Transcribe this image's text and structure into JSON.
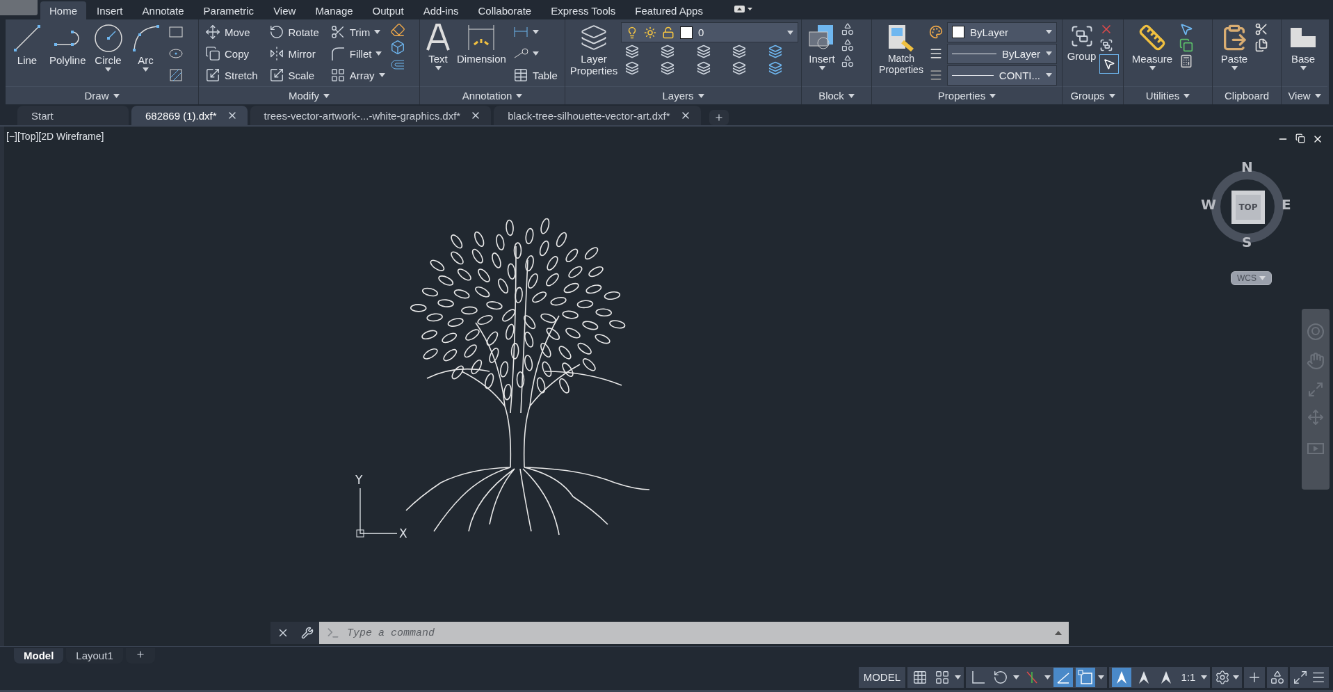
{
  "menu_tabs": [
    {
      "label": "Home",
      "selected": true
    },
    {
      "label": "Insert",
      "selected": false
    },
    {
      "label": "Annotate",
      "selected": false
    },
    {
      "label": "Parametric",
      "selected": false
    },
    {
      "label": "View",
      "selected": false
    },
    {
      "label": "Manage",
      "selected": false
    },
    {
      "label": "Output",
      "selected": false
    },
    {
      "label": "Add-ins",
      "selected": false
    },
    {
      "label": "Collaborate",
      "selected": false
    },
    {
      "label": "Express Tools",
      "selected": false
    },
    {
      "label": "Featured Apps",
      "selected": false
    }
  ],
  "ribbon": {
    "draw": {
      "title": "Draw",
      "tools": [
        "Line",
        "Polyline",
        "Circle",
        "Arc"
      ]
    },
    "modify": {
      "title": "Modify",
      "tools": [
        "Move",
        "Rotate",
        "Trim",
        "Copy",
        "Mirror",
        "Fillet",
        "Stretch",
        "Scale",
        "Array"
      ]
    },
    "annotation": {
      "title": "Annotation",
      "tools": [
        "Text",
        "Dimension"
      ],
      "table": "Table"
    },
    "layers": {
      "title": "Layers",
      "properties": "Layer Properties",
      "current_layer": "0"
    },
    "block": {
      "title": "Block",
      "insert": "Insert"
    },
    "properties": {
      "title": "Properties",
      "match": "Match Properties",
      "color_setting": "ByLayer",
      "lineweight": "ByLayer",
      "linetype": "CONTI..."
    },
    "groups": {
      "title": "Groups",
      "group": "Group"
    },
    "utilities": {
      "title": "Utilities",
      "measure": "Measure"
    },
    "clipboard": {
      "title": "Clipboard",
      "paste": "Paste"
    },
    "view": {
      "title": "View",
      "base": "Base"
    }
  },
  "doc_tabs": [
    {
      "label": "Start",
      "selected": false,
      "closable": false
    },
    {
      "label": "682869 (1).dxf*",
      "selected": true,
      "closable": true
    },
    {
      "label": "trees-vector-artwork-...-white-graphics.dxf*",
      "selected": false,
      "closable": true
    },
    {
      "label": "black-tree-silhouette-vector-art.dxf*",
      "selected": false,
      "closable": true
    }
  ],
  "viewport": {
    "label": "[−][Top][2D Wireframe]",
    "compass": {
      "north": "N",
      "south": "S",
      "east": "E",
      "west": "W",
      "face": "TOP"
    },
    "ucs_menu": "WCS",
    "axis_x": "X",
    "axis_y": "Y"
  },
  "command_line": {
    "placeholder": "Type a command"
  },
  "layout_tabs": [
    {
      "label": "Model",
      "selected": true
    },
    {
      "label": "Layout1",
      "selected": false
    }
  ],
  "status_bar": {
    "space": "MODEL",
    "scale": "1:1",
    "toggles": [
      {
        "on": false
      },
      {
        "on": false
      },
      {
        "on": false
      },
      {
        "on": false
      },
      {
        "on": false
      },
      {
        "on": true
      },
      {
        "on": true
      },
      {
        "on": true
      },
      {
        "on": false
      },
      {
        "on": false
      }
    ]
  }
}
